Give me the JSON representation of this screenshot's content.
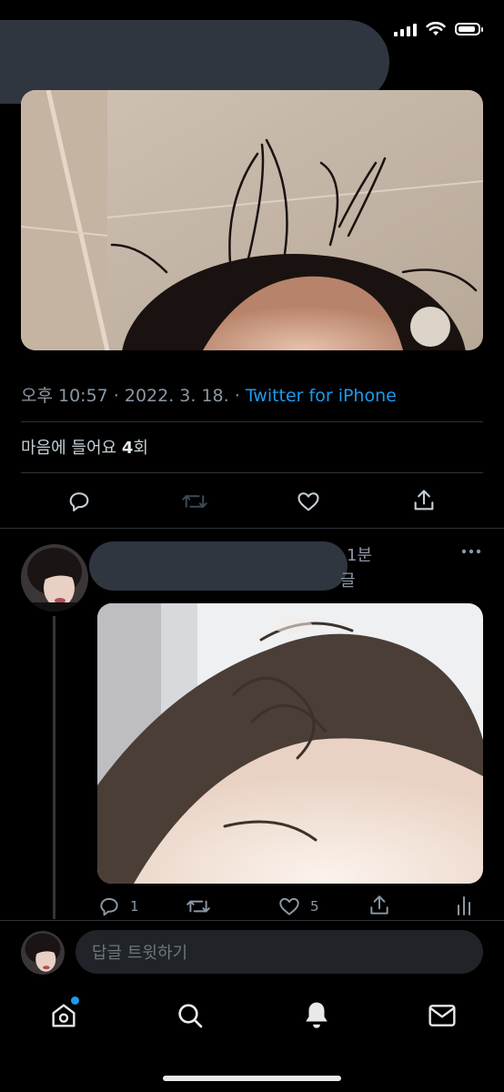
{
  "tweet": {
    "timestamp": "오후 10:57 · 2022. 3. 18. · ",
    "source": "Twitter for iPhone",
    "likes_prefix": "마음에 들어요 ",
    "likes_count": "4",
    "likes_suffix": "회"
  },
  "reply": {
    "time_fragment": "1분",
    "subtitle_fragment": "글",
    "reply_count": "1",
    "like_count": "5"
  },
  "composer": {
    "placeholder": "답글 트윗하기"
  },
  "colors": {
    "accent": "#1d9bf0",
    "background": "#000000",
    "muted": "#8b98a5",
    "redaction": "#2f3640"
  },
  "icons": [
    "reply-icon",
    "retweet-icon",
    "like-icon",
    "share-icon",
    "analytics-icon",
    "more-icon",
    "home-icon",
    "search-icon",
    "notifications-icon",
    "messages-icon"
  ]
}
